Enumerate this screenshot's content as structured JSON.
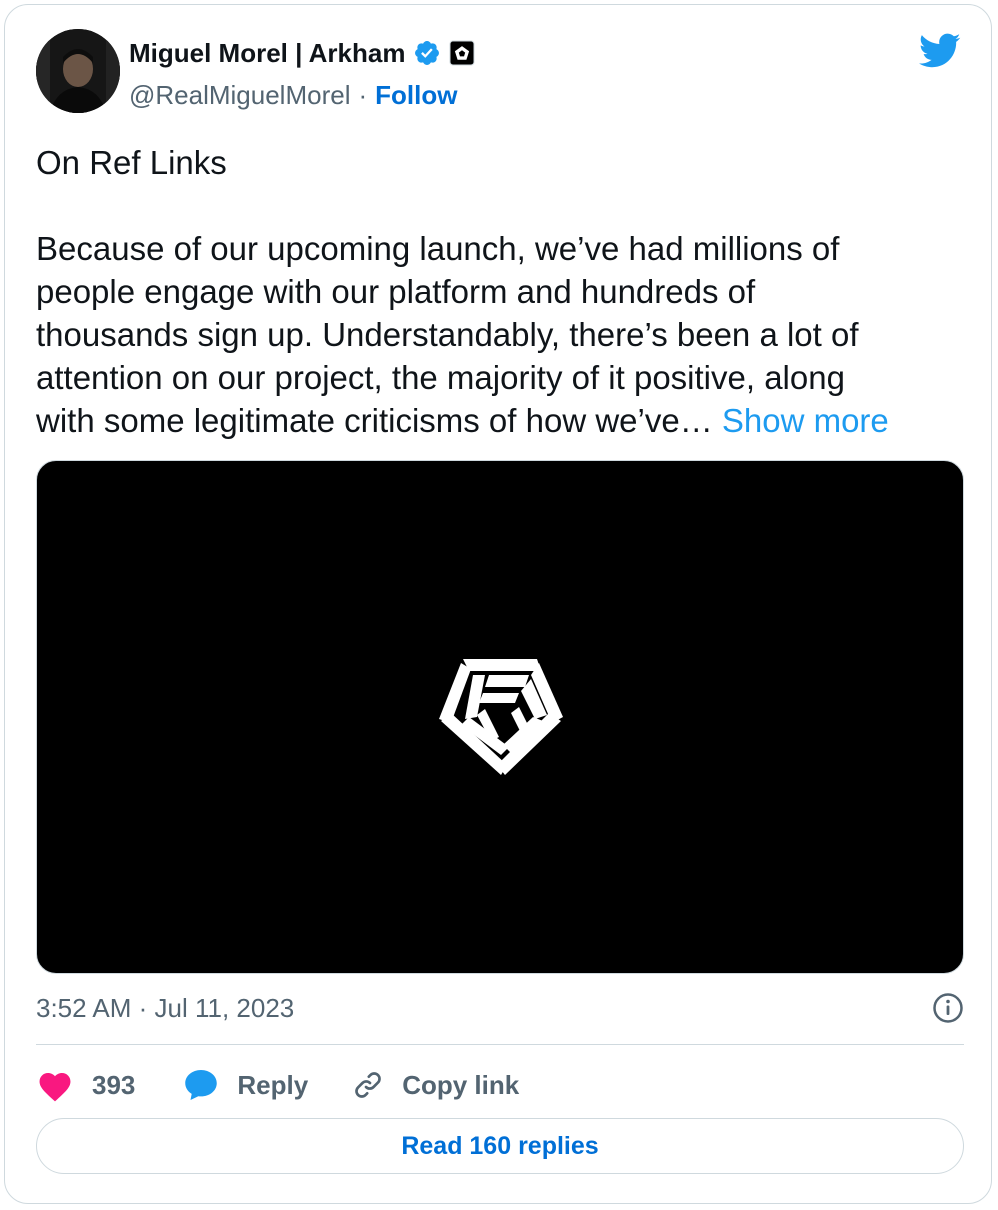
{
  "author": {
    "name": "Miguel Morel | Arkham",
    "handle": "@RealMiguelMorel",
    "separator": "·",
    "follow_label": "Follow",
    "verified_icon": "verified-badge-icon",
    "affiliate_icon": "arkham-affiliate-icon"
  },
  "tweet": {
    "paragraphs": [
      "On Ref Links"
    ],
    "body_lines": [
      "Because of our upcoming launch, we’ve had millions of",
      "people engage with our platform and hundreds of",
      "thousands sign up. Understandably, there’s been a lot of",
      "attention on our project, the majority of it positive, along",
      "with some legitimate criticisms of how we’ve…"
    ],
    "show_more_label": "Show more",
    "timestamp": "3:52 AM · Jul 11, 2023"
  },
  "media": {
    "logo_icon": "arkham-logo-icon",
    "background": "#000000"
  },
  "actions": {
    "like_count": "393",
    "reply_label": "Reply",
    "copy_link_label": "Copy link"
  },
  "read_replies_label": "Read 160 replies",
  "colors": {
    "link_blue": "#006fd6",
    "show_more_blue": "#1d9bf0",
    "like_pink": "#f91880",
    "secondary_text": "#536471",
    "border": "#cfd9de"
  }
}
